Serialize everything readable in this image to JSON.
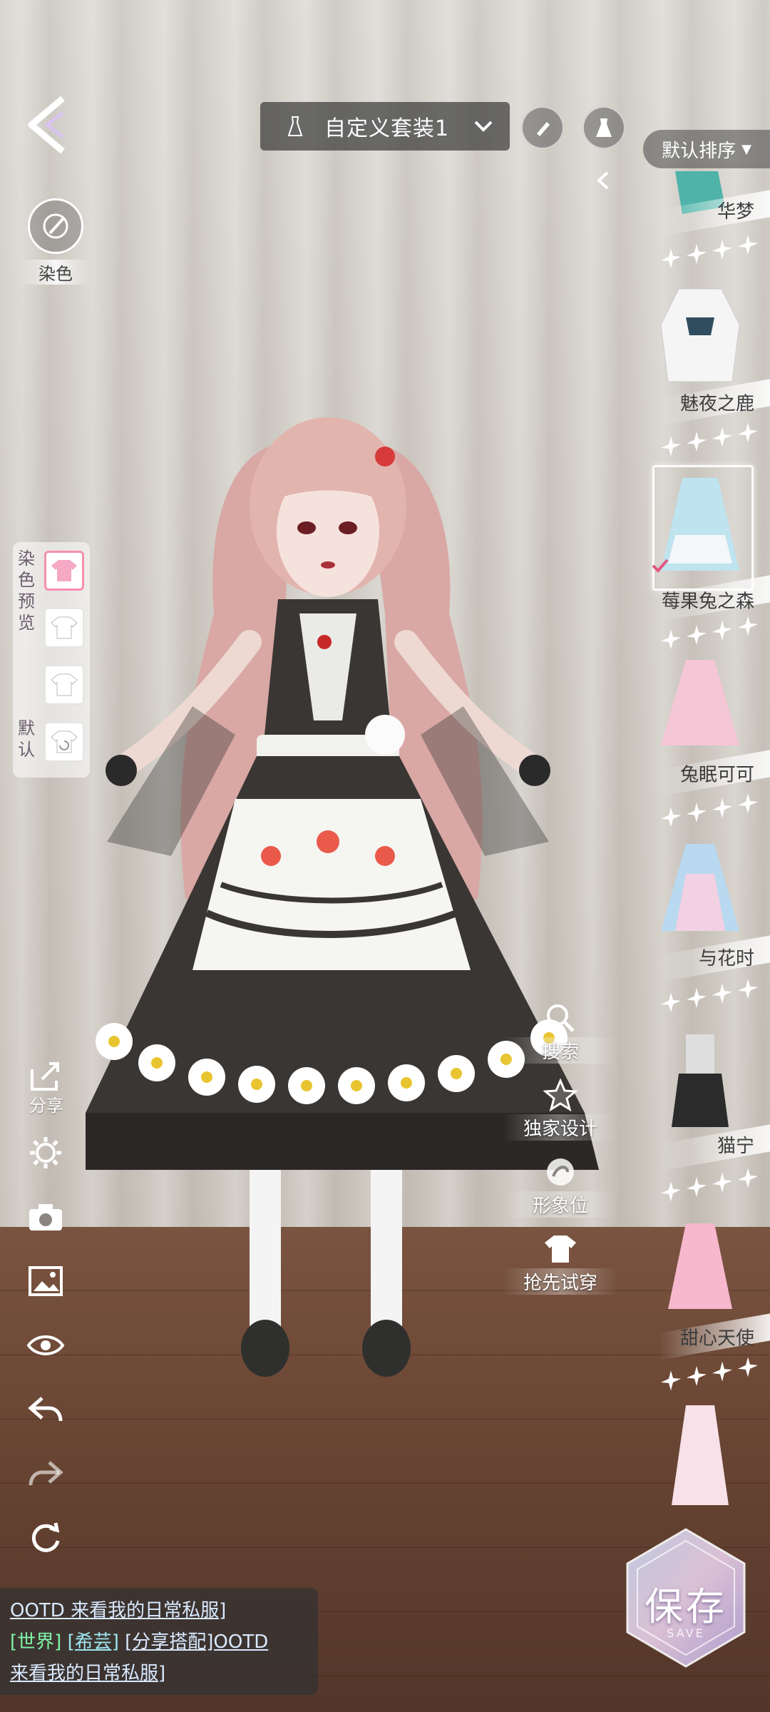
{
  "header": {
    "outfit_name": "自定义套装1",
    "sort_label": "默认排序"
  },
  "dye": {
    "label": "染色",
    "preview_label": "染色预览",
    "default_label": "默认"
  },
  "left_tools": [
    {
      "name": "share",
      "label": "分享"
    },
    {
      "name": "settings",
      "label": ""
    },
    {
      "name": "camera",
      "label": ""
    },
    {
      "name": "gallery",
      "label": ""
    },
    {
      "name": "view",
      "label": ""
    },
    {
      "name": "undo",
      "label": ""
    },
    {
      "name": "redo",
      "label": ""
    },
    {
      "name": "reset",
      "label": ""
    }
  ],
  "action_buttons": [
    {
      "name": "search",
      "label": "搜索"
    },
    {
      "name": "exclusive-design",
      "label": "独家设计"
    },
    {
      "name": "image-position",
      "label": "形象位"
    },
    {
      "name": "early-try-on",
      "label": "抢先试穿"
    }
  ],
  "items": [
    {
      "name": "华梦",
      "stars": 4,
      "selected": false,
      "color": "#4fb3a9"
    },
    {
      "name": "魅夜之鹿",
      "stars": 4,
      "selected": false,
      "color": "#f2f2f2"
    },
    {
      "name": "莓果兔之森",
      "stars": 4,
      "selected": true,
      "color": "#bfe3ef"
    },
    {
      "name": "兔眠可可",
      "stars": 4,
      "selected": false,
      "color": "#f5c6d6"
    },
    {
      "name": "与花时",
      "stars": 4,
      "selected": false,
      "color": "#b9d9f0"
    },
    {
      "name": "猫宁",
      "stars": 4,
      "selected": false,
      "color": "#2b2b2b"
    },
    {
      "name": "甜心天使",
      "stars": 4,
      "selected": false,
      "color": "#f7b7cc"
    },
    {
      "name": "",
      "stars": 0,
      "selected": false,
      "color": "#f9e1ea"
    }
  ],
  "save": {
    "label": "保存",
    "sub": "SAVE"
  },
  "chat": {
    "line1": "OOTD 来看我的日常私服]",
    "channel": "[世界]",
    "user": "[希芸]",
    "line2_rest": "[分享搭配]OOTD",
    "line3": "来看我的日常私服]"
  },
  "colors": {
    "accent_pink": "#f48fb1",
    "chat_world": "#7ff5a8",
    "chat_user": "#9de6f0"
  }
}
